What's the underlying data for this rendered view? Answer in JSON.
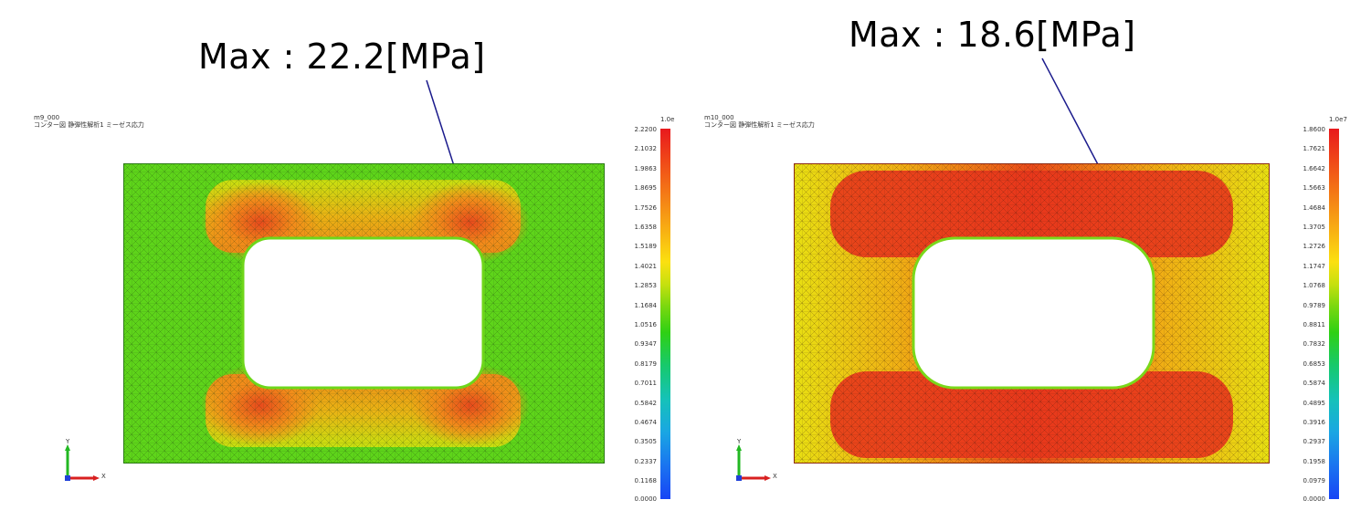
{
  "panels": [
    {
      "max_label": "Max : 22.2[MPa]",
      "model_name": "m9_000",
      "plot_title": "コンター図 静弾性解析1 ミーゼス応力",
      "legend_unit": "1.0e",
      "legend_ticks": [
        "2.2200",
        "2.1032",
        "1.9863",
        "1.8695",
        "1.7526",
        "1.6358",
        "1.5189",
        "1.4021",
        "1.2853",
        "1.1684",
        "1.0516",
        "0.9347",
        "0.8179",
        "0.7011",
        "0.5842",
        "0.4674",
        "0.3505",
        "0.2337",
        "0.1168",
        "0.0000"
      ],
      "axis_x": "X",
      "axis_y": "Y"
    },
    {
      "max_label": "Max : 18.6[MPa]",
      "model_name": "m10_000",
      "plot_title": "コンター図 静弾性解析1 ミーゼス応力",
      "legend_unit": "1.0e7",
      "legend_ticks": [
        "1.8600",
        "1.7621",
        "1.6642",
        "1.5663",
        "1.4684",
        "1.3705",
        "1.2726",
        "1.1747",
        "1.0768",
        "0.9789",
        "0.8811",
        "0.7832",
        "0.6853",
        "0.5874",
        "0.4895",
        "0.3916",
        "0.2937",
        "0.1958",
        "0.0979",
        "0.0000"
      ],
      "axis_x": "X",
      "axis_y": "Y"
    }
  ],
  "colors": {
    "legend_scale": [
      "#e8191d",
      "#f04a18",
      "#f47c16",
      "#f8ad13",
      "#fbe010",
      "#c6e00f",
      "#7ad80f",
      "#2fd014",
      "#17c96d",
      "#15c2b8",
      "#1aa6e3",
      "#1a74f0",
      "#1744f5"
    ],
    "pointer_line": "#1a1a8c"
  }
}
